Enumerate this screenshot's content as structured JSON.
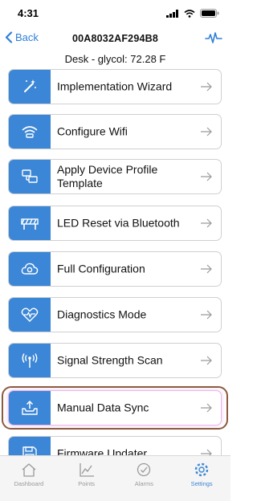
{
  "status_bar": {
    "time": "4:31"
  },
  "nav": {
    "back_label": "Back",
    "title": "00A8032AF294B8"
  },
  "device_status": "Desk - glycol: 72.28 F",
  "menu": [
    {
      "label": "Implementation Wizard",
      "icon": "magic-wand-icon"
    },
    {
      "label": "Configure Wifi",
      "icon": "wifi-icon"
    },
    {
      "label": "Apply Device Profile Template",
      "icon": "devices-icon"
    },
    {
      "label": "LED Reset via Bluetooth",
      "icon": "barrier-icon"
    },
    {
      "label": "Full Configuration",
      "icon": "cloud-gear-icon"
    },
    {
      "label": "Diagnostics Mode",
      "icon": "heart-pulse-icon"
    },
    {
      "label": "Signal Strength Scan",
      "icon": "antenna-icon"
    },
    {
      "label": "Manual Data Sync",
      "icon": "upload-tray-icon"
    },
    {
      "label": "Firmware Updater",
      "icon": "floppy-icon"
    }
  ],
  "tabs": [
    {
      "label": "Dashboard",
      "icon": "home-icon",
      "active": false
    },
    {
      "label": "Points",
      "icon": "chart-icon",
      "active": false
    },
    {
      "label": "Alarms",
      "icon": "alarm-icon",
      "active": false
    },
    {
      "label": "Settings",
      "icon": "gear-icon",
      "active": true
    }
  ],
  "colors": {
    "accent": "#3b86d6",
    "highlight_ring": "#8c5a3e",
    "tab_inactive": "#999999"
  }
}
